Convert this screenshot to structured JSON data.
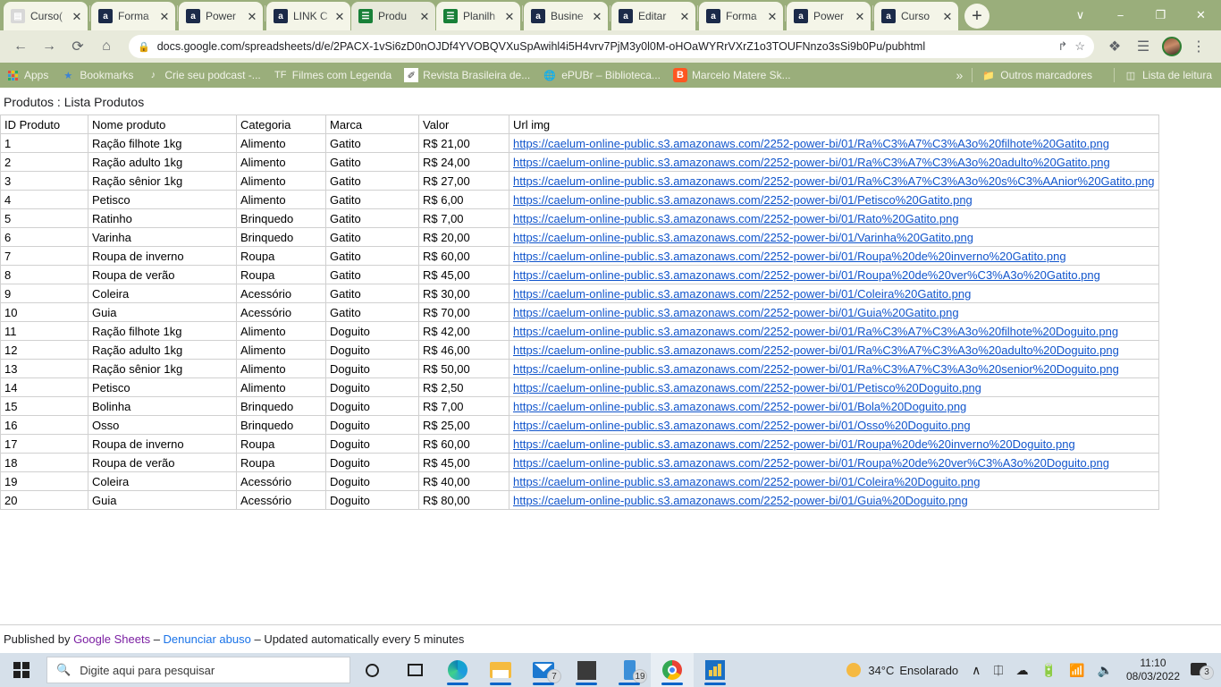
{
  "browser": {
    "tabs": [
      {
        "title": "Curso(",
        "icon": "page-icon",
        "icon_kind": "gray",
        "active": false
      },
      {
        "title": "Forma",
        "icon": "alura-icon",
        "icon_kind": "a",
        "active": false
      },
      {
        "title": "Power",
        "icon": "alura-icon",
        "icon_kind": "a",
        "active": false
      },
      {
        "title": "LINK C",
        "icon": "alura-icon",
        "icon_kind": "a",
        "active": false
      },
      {
        "title": "Produ",
        "icon": "google-sheets-icon",
        "icon_kind": "sheets",
        "active": true
      },
      {
        "title": "Planilh",
        "icon": "google-sheets-icon",
        "icon_kind": "sheets",
        "active": false
      },
      {
        "title": "Busine",
        "icon": "alura-icon",
        "icon_kind": "a",
        "active": false
      },
      {
        "title": "Editar",
        "icon": "alura-icon",
        "icon_kind": "a",
        "active": false
      },
      {
        "title": "Forma",
        "icon": "alura-icon",
        "icon_kind": "a",
        "active": false
      },
      {
        "title": "Power",
        "icon": "alura-icon",
        "icon_kind": "a",
        "active": false
      },
      {
        "title": "Curso",
        "icon": "alura-icon",
        "icon_kind": "a",
        "active": false
      }
    ],
    "new_tab_label": "+",
    "close_label": "✕",
    "window_controls": {
      "tab_search": "∨",
      "minimize": "−",
      "maximize": "❐",
      "close": "✕"
    },
    "nav": {
      "back": "←",
      "forward": "→",
      "reload": "⟳",
      "home": "⌂"
    },
    "omnibox": {
      "lock_icon": "lock-icon",
      "url": "docs.google.com/spreadsheets/d/e/2PACX-1vSi6zD0nOJDf4YVOBQVXuSpAwihl4i5H4vrv7PjM3y0l0M-oHOaWYRrVXrZ1o3TOUFNnzo3sSi9b0Pu/pubhtml",
      "share_icon": "↱",
      "bookmark_icon": "☆"
    },
    "toolbar_right": {
      "extensions": "❖",
      "reading_list": "☰",
      "menu": "⋮"
    },
    "bookmarks": [
      {
        "label": "Apps",
        "icon": "apps-grid-icon"
      },
      {
        "label": "Bookmarks",
        "icon": "star-icon"
      },
      {
        "label": "Crie seu podcast -...",
        "icon": "podcast-icon"
      },
      {
        "label": "Filmes com Legenda",
        "icon": "tf-icon"
      },
      {
        "label": "Revista Brasileira de...",
        "icon": "magazine-icon"
      },
      {
        "label": "ePUBr – Biblioteca...",
        "icon": "globe-icon"
      },
      {
        "label": "Marcelo Matere Sk...",
        "icon": "blogger-icon"
      }
    ],
    "bookmarks_overflow": "»",
    "bookmarks_right": [
      {
        "label": "Outros marcadores",
        "icon": "folder-icon"
      },
      {
        "label": "Lista de leitura",
        "icon": "reading-list-icon"
      }
    ]
  },
  "sheet": {
    "title": "Produtos : Lista Produtos",
    "columns": [
      "ID Produto",
      "Nome produto",
      "Categoria",
      "Marca",
      "Valor",
      "Url img"
    ],
    "rows": [
      {
        "id": "1",
        "nome": "Ração filhote 1kg",
        "categoria": "Alimento",
        "marca": "Gatito",
        "valor": "R$ 21,00",
        "url": "https://caelum-online-public.s3.amazonaws.com/2252-power-bi/01/Ra%C3%A7%C3%A3o%20filhote%20Gatito.png"
      },
      {
        "id": "2",
        "nome": "Ração adulto 1kg",
        "categoria": "Alimento",
        "marca": "Gatito",
        "valor": "R$ 24,00",
        "url": "https://caelum-online-public.s3.amazonaws.com/2252-power-bi/01/Ra%C3%A7%C3%A3o%20adulto%20Gatito.png"
      },
      {
        "id": "3",
        "nome": "Ração sênior 1kg",
        "categoria": "Alimento",
        "marca": "Gatito",
        "valor": "R$ 27,00",
        "url": "https://caelum-online-public.s3.amazonaws.com/2252-power-bi/01/Ra%C3%A7%C3%A3o%20s%C3%AAnior%20Gatito.png"
      },
      {
        "id": "4",
        "nome": "Petisco",
        "categoria": "Alimento",
        "marca": "Gatito",
        "valor": "R$ 6,00",
        "url": "https://caelum-online-public.s3.amazonaws.com/2252-power-bi/01/Petisco%20Gatito.png"
      },
      {
        "id": "5",
        "nome": "Ratinho",
        "categoria": "Brinquedo",
        "marca": "Gatito",
        "valor": "R$ 7,00",
        "url": "https://caelum-online-public.s3.amazonaws.com/2252-power-bi/01/Rato%20Gatito.png"
      },
      {
        "id": "6",
        "nome": "Varinha",
        "categoria": "Brinquedo",
        "marca": "Gatito",
        "valor": "R$ 20,00",
        "url": "https://caelum-online-public.s3.amazonaws.com/2252-power-bi/01/Varinha%20Gatito.png"
      },
      {
        "id": "7",
        "nome": "Roupa de inverno",
        "categoria": "Roupa",
        "marca": "Gatito",
        "valor": "R$ 60,00",
        "url": "https://caelum-online-public.s3.amazonaws.com/2252-power-bi/01/Roupa%20de%20inverno%20Gatito.png"
      },
      {
        "id": "8",
        "nome": "Roupa de verão",
        "categoria": "Roupa",
        "marca": "Gatito",
        "valor": "R$ 45,00",
        "url": "https://caelum-online-public.s3.amazonaws.com/2252-power-bi/01/Roupa%20de%20ver%C3%A3o%20Gatito.png"
      },
      {
        "id": "9",
        "nome": "Coleira",
        "categoria": "Acessório",
        "marca": "Gatito",
        "valor": "R$ 30,00",
        "url": "https://caelum-online-public.s3.amazonaws.com/2252-power-bi/01/Coleira%20Gatito.png"
      },
      {
        "id": "10",
        "nome": "Guia",
        "categoria": "Acessório",
        "marca": "Gatito",
        "valor": "R$ 70,00",
        "url": "https://caelum-online-public.s3.amazonaws.com/2252-power-bi/01/Guia%20Gatito.png"
      },
      {
        "id": "11",
        "nome": "Ração filhote 1kg",
        "categoria": "Alimento",
        "marca": "Doguito",
        "valor": "R$ 42,00",
        "url": "https://caelum-online-public.s3.amazonaws.com/2252-power-bi/01/Ra%C3%A7%C3%A3o%20filhote%20Doguito.png"
      },
      {
        "id": "12",
        "nome": "Ração adulto 1kg",
        "categoria": "Alimento",
        "marca": "Doguito",
        "valor": "R$ 46,00",
        "url": "https://caelum-online-public.s3.amazonaws.com/2252-power-bi/01/Ra%C3%A7%C3%A3o%20adulto%20Doguito.png"
      },
      {
        "id": "13",
        "nome": "Ração sênior 1kg",
        "categoria": "Alimento",
        "marca": "Doguito",
        "valor": "R$ 50,00",
        "url": "https://caelum-online-public.s3.amazonaws.com/2252-power-bi/01/Ra%C3%A7%C3%A3o%20senior%20Doguito.png"
      },
      {
        "id": "14",
        "nome": "Petisco",
        "categoria": "Alimento",
        "marca": "Doguito",
        "valor": "R$ 2,50",
        "url": "https://caelum-online-public.s3.amazonaws.com/2252-power-bi/01/Petisco%20Doguito.png"
      },
      {
        "id": "15",
        "nome": "Bolinha",
        "categoria": "Brinquedo",
        "marca": "Doguito",
        "valor": "R$ 7,00",
        "url": "https://caelum-online-public.s3.amazonaws.com/2252-power-bi/01/Bola%20Doguito.png"
      },
      {
        "id": "16",
        "nome": "Osso",
        "categoria": "Brinquedo",
        "marca": "Doguito",
        "valor": "R$ 25,00",
        "url": "https://caelum-online-public.s3.amazonaws.com/2252-power-bi/01/Osso%20Doguito.png"
      },
      {
        "id": "17",
        "nome": "Roupa de inverno",
        "categoria": "Roupa",
        "marca": "Doguito",
        "valor": "R$ 60,00",
        "url": "https://caelum-online-public.s3.amazonaws.com/2252-power-bi/01/Roupa%20de%20inverno%20Doguito.png"
      },
      {
        "id": "18",
        "nome": "Roupa de verão",
        "categoria": "Roupa",
        "marca": "Doguito",
        "valor": "R$ 45,00",
        "url": "https://caelum-online-public.s3.amazonaws.com/2252-power-bi/01/Roupa%20de%20ver%C3%A3o%20Doguito.png"
      },
      {
        "id": "19",
        "nome": "Coleira",
        "categoria": "Acessório",
        "marca": "Doguito",
        "valor": "R$ 40,00",
        "url": "https://caelum-online-public.s3.amazonaws.com/2252-power-bi/01/Coleira%20Doguito.png"
      },
      {
        "id": "20",
        "nome": "Guia",
        "categoria": "Acessório",
        "marca": "Doguito",
        "valor": "R$ 80,00",
        "url": "https://caelum-online-public.s3.amazonaws.com/2252-power-bi/01/Guia%20Doguito.png"
      }
    ]
  },
  "footer": {
    "published_by": "Published by ",
    "google_sheets": "Google Sheets",
    "dash1": " – ",
    "report_abuse": "Denunciar abuso",
    "dash2": " – ",
    "updated": "Updated automatically every 5 minutes"
  },
  "taskbar": {
    "start_icon": "windows-start-icon",
    "search_placeholder": "Digite aqui para pesquisar",
    "cortana_icon": "cortana-circle-icon",
    "taskview_icon": "task-view-icon",
    "apps": [
      {
        "name": "edge-icon",
        "badge": "",
        "running": true,
        "active": false
      },
      {
        "name": "file-explorer-icon",
        "badge": "",
        "running": true,
        "active": false
      },
      {
        "name": "mail-icon",
        "badge": "7",
        "running": true,
        "active": false
      },
      {
        "name": "sticky-notes-icon",
        "badge": "",
        "running": true,
        "active": false
      },
      {
        "name": "your-phone-icon",
        "badge": "19",
        "running": true,
        "active": false
      },
      {
        "name": "chrome-icon",
        "badge": "",
        "running": true,
        "active": true
      },
      {
        "name": "power-bi-icon",
        "badge": "",
        "running": true,
        "active": false
      }
    ],
    "weather": {
      "temp": "34°C",
      "condition": "Ensolarado",
      "icon": "sun-icon"
    },
    "tray": [
      {
        "name": "show-hidden-icons",
        "glyph": "∧"
      },
      {
        "name": "onedrive-sync-icon",
        "glyph": "❐"
      },
      {
        "name": "cloud-icon",
        "glyph": "☁"
      },
      {
        "name": "battery-icon",
        "glyph": "▧"
      },
      {
        "name": "wifi-icon",
        "glyph": "◠"
      },
      {
        "name": "volume-icon",
        "glyph": "ᴘ"
      }
    ],
    "clock": {
      "time": "11:10",
      "date": "08/03/2022"
    },
    "notifications": {
      "icon": "notification-icon",
      "count": "3"
    }
  },
  "colors": {
    "chrome_frame": "#9aae7b",
    "tab_active": "#e8eadb",
    "link": "#1155cc",
    "sheets_green": "#188038",
    "taskbar": "#d6e0ea"
  }
}
